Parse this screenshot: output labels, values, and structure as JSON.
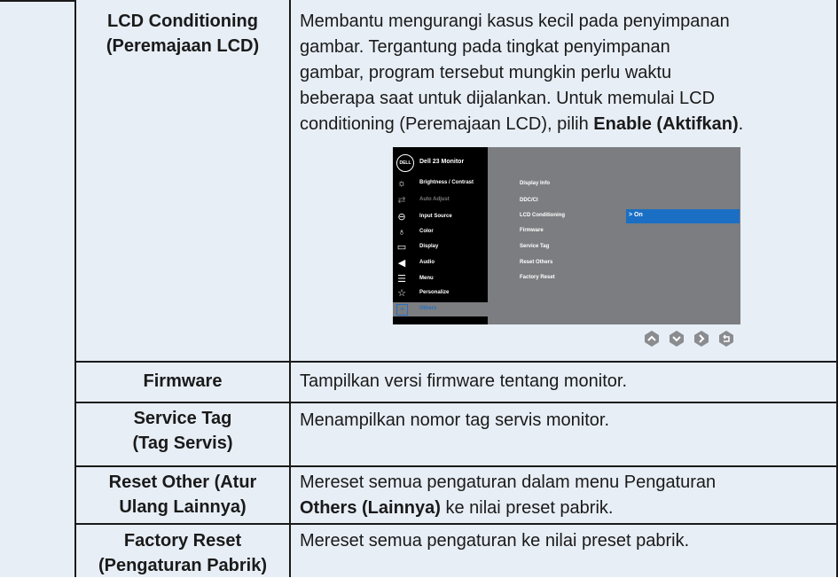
{
  "rows": [
    {
      "label_lines": [
        "LCD Conditioning",
        "(Peremajaan LCD)"
      ],
      "desc_parts": [
        "Membantu mengurangi kasus kecil pada penyimpanan",
        "gambar. Tergantung pada tingkat penyimpanan",
        "gambar, program tersebut mungkin perlu waktu",
        "beberapa saat untuk dijalankan. Untuk memulai LCD",
        "conditioning (Peremajaan LCD), pilih "
      ],
      "desc_bold_tail": "Enable (Aktifkan)",
      "desc_end": "."
    },
    {
      "label_lines": [
        "Firmware"
      ],
      "desc": "Tampilkan versi firmware tentang monitor."
    },
    {
      "label_lines": [
        "Service Tag",
        "(Tag Servis)"
      ],
      "desc": "Menampilkan nomor tag servis monitor."
    },
    {
      "label_lines": [
        "Reset Other (Atur",
        "Ulang Lainnya)"
      ],
      "desc_line1": "Mereset semua pengaturan dalam menu Pengaturan",
      "desc_bold": "Others (Lainnya)",
      "desc_line2_tail": " ke nilai preset pabrik."
    },
    {
      "label_lines": [
        "Factory Reset",
        "(Pengaturan Pabrik)"
      ],
      "desc": "Mereset semua pengaturan ke nilai preset pabrik."
    }
  ],
  "osd": {
    "logo": "DELL",
    "title": "Dell 23 Monitor",
    "menu": [
      {
        "icon": "brightness-icon",
        "glyph": "☼",
        "label": "Brightness / Contrast",
        "state": "normal"
      },
      {
        "icon": "auto-adjust-icon",
        "glyph": "⇄",
        "label": "Auto Adjust",
        "state": "dim"
      },
      {
        "icon": "input-source-icon",
        "glyph": "⊖",
        "label": "Input Source",
        "state": "normal"
      },
      {
        "icon": "color-icon",
        "glyph": "♁",
        "label": "Color",
        "state": "normal"
      },
      {
        "icon": "display-icon",
        "glyph": "▭",
        "label": "Display",
        "state": "normal"
      },
      {
        "icon": "audio-icon",
        "glyph": "◀",
        "label": "Audio",
        "state": "normal"
      },
      {
        "icon": "menu-icon",
        "glyph": "☰",
        "label": "Menu",
        "state": "normal"
      },
      {
        "icon": "personalize-icon",
        "glyph": "☆",
        "label": "Personalize",
        "state": "normal"
      },
      {
        "icon": "others-icon",
        "glyph": "≡",
        "label": "Others",
        "state": "selected"
      }
    ],
    "submenu": [
      "Display Info",
      "DDC/CI",
      "LCD Conditioning",
      "Firmware",
      "Service Tag",
      "Reset Others",
      "Factory Reset"
    ],
    "highlight_value": "> On",
    "colors": {
      "highlight": "#1a6fc4",
      "panel": "#7b7d80",
      "sidebar": "#000000"
    }
  },
  "nav_buttons": [
    "up-icon",
    "down-icon",
    "right-icon",
    "back-icon"
  ]
}
